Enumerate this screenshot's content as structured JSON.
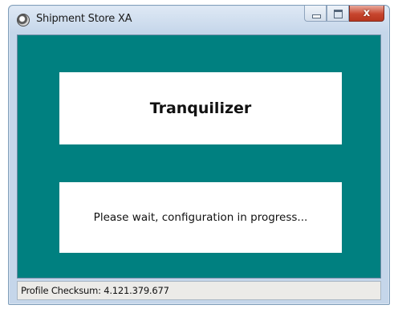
{
  "window": {
    "title": "Shipment Store XA",
    "icon": "app-disc-icon"
  },
  "caption_buttons": {
    "minimize_icon": "minimize-icon",
    "maximize_icon": "maximize-icon",
    "close_icon": "close-icon",
    "close_glyph": "x"
  },
  "main": {
    "heading": "Tranquilizer",
    "status_message": "Please wait, configuration in progress..."
  },
  "status_bar": {
    "text": "Profile Checksum: 4.121.379.677"
  },
  "colors": {
    "client_background": "#008080",
    "panel_background": "#ffffff",
    "close_button": "#c7452e"
  }
}
